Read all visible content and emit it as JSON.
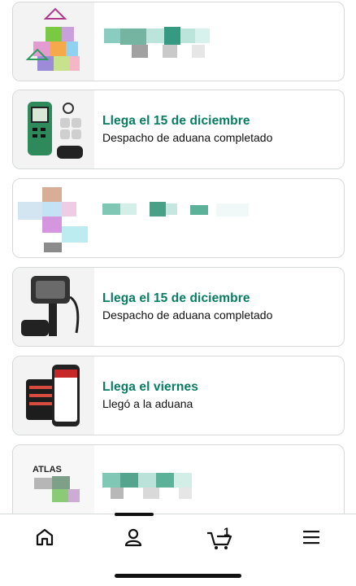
{
  "orders": [
    {
      "title": "",
      "subtitle": ""
    },
    {
      "title": "Llega el 15 de diciembre",
      "subtitle": "Despacho de aduana completado"
    },
    {
      "title": "",
      "subtitle": ""
    },
    {
      "title": "Llega el 15 de diciembre",
      "subtitle": "Despacho de aduana completado"
    },
    {
      "title": "Llega el viernes",
      "subtitle": "Llegó a la aduana"
    },
    {
      "title": "",
      "subtitle": ""
    }
  ],
  "atlas_label": "ATLAS",
  "nav": {
    "items": [
      "home-icon",
      "account-icon",
      "cart-icon",
      "menu-icon"
    ],
    "cart_count": "1"
  },
  "colors": {
    "accent": "#067d62",
    "border": "#d5d9d9"
  }
}
